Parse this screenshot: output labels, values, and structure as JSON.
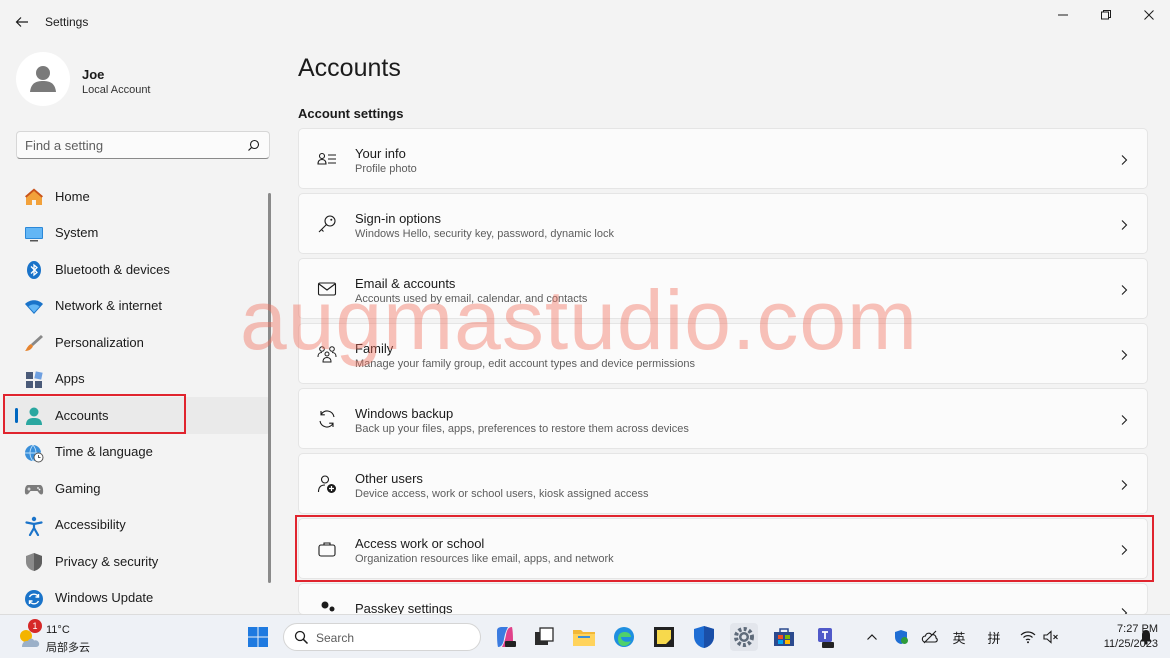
{
  "window": {
    "title": "Settings"
  },
  "profile": {
    "name": "Joe",
    "account_type": "Local Account"
  },
  "search": {
    "placeholder": "Find a setting"
  },
  "sidebar": {
    "items": [
      {
        "label": "Home",
        "icon": "home-icon"
      },
      {
        "label": "System",
        "icon": "monitor-icon"
      },
      {
        "label": "Bluetooth & devices",
        "icon": "bluetooth-icon"
      },
      {
        "label": "Network & internet",
        "icon": "wifi-icon"
      },
      {
        "label": "Personalization",
        "icon": "brush-icon"
      },
      {
        "label": "Apps",
        "icon": "apps-icon"
      },
      {
        "label": "Accounts",
        "icon": "person-icon",
        "active": true
      },
      {
        "label": "Time & language",
        "icon": "globe-clock-icon"
      },
      {
        "label": "Gaming",
        "icon": "gamepad-icon"
      },
      {
        "label": "Accessibility",
        "icon": "accessibility-icon"
      },
      {
        "label": "Privacy & security",
        "icon": "shield-icon"
      },
      {
        "label": "Windows Update",
        "icon": "update-icon"
      }
    ]
  },
  "main": {
    "page_title": "Accounts",
    "section_title": "Account settings",
    "cards": [
      {
        "title": "Your info",
        "subtitle": "Profile photo",
        "icon": "contact-card-icon"
      },
      {
        "title": "Sign-in options",
        "subtitle": "Windows Hello, security key, password, dynamic lock",
        "icon": "key-icon"
      },
      {
        "title": "Email & accounts",
        "subtitle": "Accounts used by email, calendar, and contacts",
        "icon": "mail-icon"
      },
      {
        "title": "Family",
        "subtitle": "Manage your family group, edit account types and device permissions",
        "icon": "family-icon"
      },
      {
        "title": "Windows backup",
        "subtitle": "Back up your files, apps, preferences to restore them across devices",
        "icon": "sync-icon"
      },
      {
        "title": "Other users",
        "subtitle": "Device access, work or school users, kiosk assigned access",
        "icon": "add-person-icon"
      },
      {
        "title": "Access work or school",
        "subtitle": "Organization resources like email, apps, and network",
        "icon": "briefcase-icon"
      },
      {
        "title": "Passkey settings",
        "subtitle": "",
        "icon": "passkey-icon"
      }
    ]
  },
  "watermark": {
    "text": "augmastudio.com"
  },
  "taskbar": {
    "weather_temp": "11°C",
    "weather_desc": "局部多云",
    "weather_badge": "1",
    "search_label": "Search",
    "ime_lang": "英",
    "ime_mode": "拼",
    "time": "7:27 PM",
    "date": "11/25/2023"
  },
  "colors": {
    "accent": "#0067c0",
    "highlight_box": "#e0242e",
    "watermark": "#f06e5a"
  }
}
